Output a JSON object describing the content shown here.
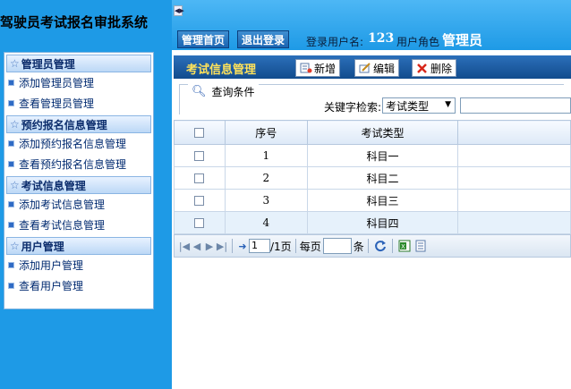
{
  "app": {
    "title": "驾驶员考试报名审批系统"
  },
  "topbar": {
    "home_label": "管理首页",
    "logout_label": "退出登录",
    "login_user_label": "登录用户名:",
    "login_user_value": "123",
    "role_label": "用户角色",
    "role_value": "管理员"
  },
  "sidebar": {
    "groups": [
      {
        "title": "管理员管理",
        "items": [
          {
            "label": "添加管理员管理"
          },
          {
            "label": "查看管理员管理"
          }
        ]
      },
      {
        "title": "预约报名信息管理",
        "items": [
          {
            "label": "添加预约报名信息管理"
          },
          {
            "label": "查看预约报名信息管理"
          }
        ]
      },
      {
        "title": "考试信息管理",
        "items": [
          {
            "label": "添加考试信息管理"
          },
          {
            "label": "查看考试信息管理"
          }
        ]
      },
      {
        "title": "用户管理",
        "items": [
          {
            "label": "添加用户管理"
          },
          {
            "label": "查看用户管理"
          }
        ]
      }
    ]
  },
  "content": {
    "title": "考试信息管理",
    "toolbar": {
      "add_label": "新增",
      "edit_label": "编辑",
      "delete_label": "删除"
    },
    "query": {
      "title": "查询条件",
      "keyword_label": "关键字检索:",
      "keyword_selected": "考试类型",
      "keyword_value": ""
    },
    "table": {
      "headers": [
        "序号",
        "考试类型"
      ],
      "rows": [
        {
          "no": "1",
          "type": "科目一"
        },
        {
          "no": "2",
          "type": "科目二"
        },
        {
          "no": "3",
          "type": "科目三"
        },
        {
          "no": "4",
          "type": "科目四"
        }
      ]
    },
    "pager": {
      "current_page": "1",
      "total_pages": "/1页",
      "per_page_label": "每页",
      "per_page_value": "",
      "unit_label": "条"
    }
  },
  "colors": {
    "accent": "#1e9ae6",
    "header_bar": "#124c8d",
    "title_yellow": "#ffe25a"
  },
  "icons": [
    "star-icon",
    "square-bullet-icon",
    "collapse-arrow-icon",
    "add-doc-icon",
    "edit-icon",
    "delete-x-icon",
    "magnifier-icon",
    "first-page-icon",
    "prev-page-icon",
    "next-page-icon",
    "last-page-icon",
    "go-arrow-icon",
    "refresh-icon",
    "excel-export-icon",
    "doc-export-icon"
  ]
}
